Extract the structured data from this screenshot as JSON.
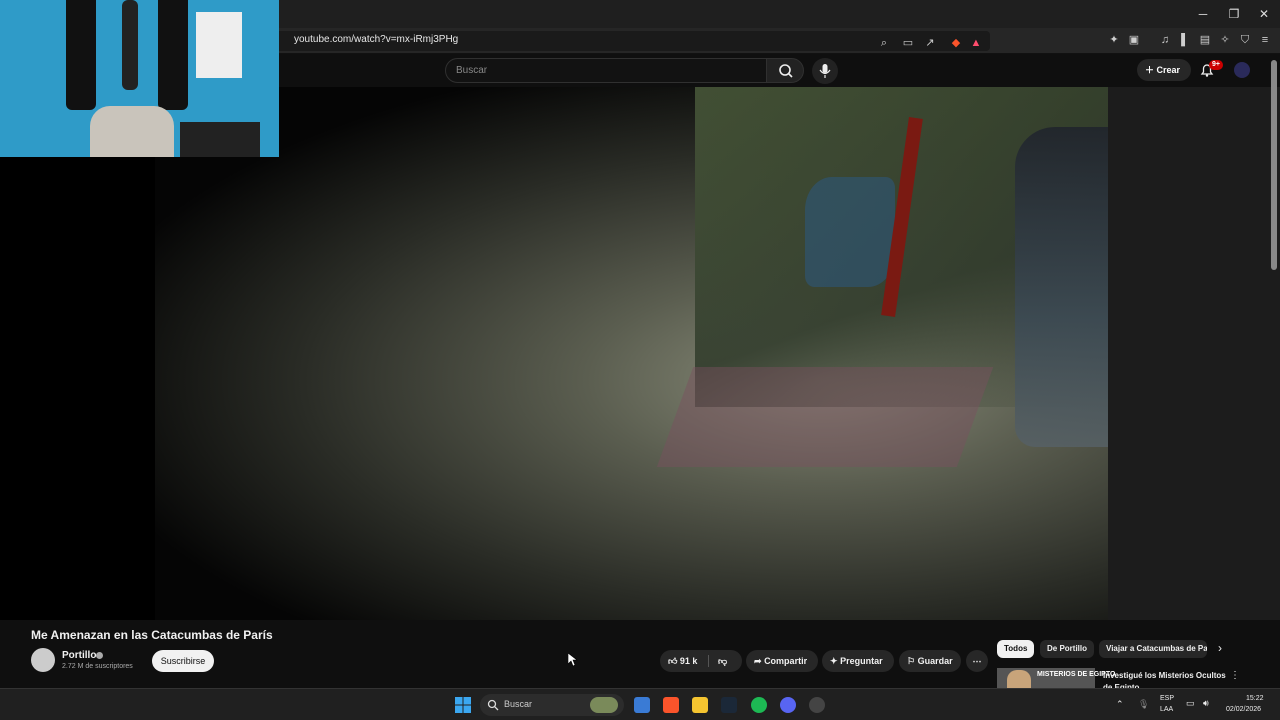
{
  "browser": {
    "url": "youtube.com/watch?v=mx-iRmj3PHg",
    "window_controls": {
      "minimize": "─",
      "restore": "❐",
      "close": "✕"
    }
  },
  "youtube": {
    "search_placeholder": "Buscar",
    "create_label": "Crear",
    "notifications_badge": "9+"
  },
  "video": {
    "title": "Me Amenazan en las Catacumbas de París",
    "channel": {
      "name": "Portillo",
      "subscribers": "2.72 M de suscriptores",
      "subscribe_label": "Suscribirse"
    },
    "actions": {
      "likes": "91 k",
      "share": "Compartir",
      "ask": "Preguntar",
      "save": "Guardar"
    }
  },
  "recommendations": {
    "chips": [
      "Todos",
      "De Portillo",
      "Viajar a Catacumbas de Pa"
    ],
    "first": {
      "thumb_text": "MISTERIOS DE EGIPTO",
      "title": "Investigué los Misterios Ocultos de Egipto"
    }
  },
  "taskbar": {
    "search_label": "Buscar",
    "language": "ESP",
    "layout": "LAA",
    "time": "15:22",
    "date": "02/02/2026"
  },
  "colors": {
    "accent_red": "#cc0000",
    "background": "#0f0f0f",
    "webcam_wall": "#2f9bc8"
  }
}
